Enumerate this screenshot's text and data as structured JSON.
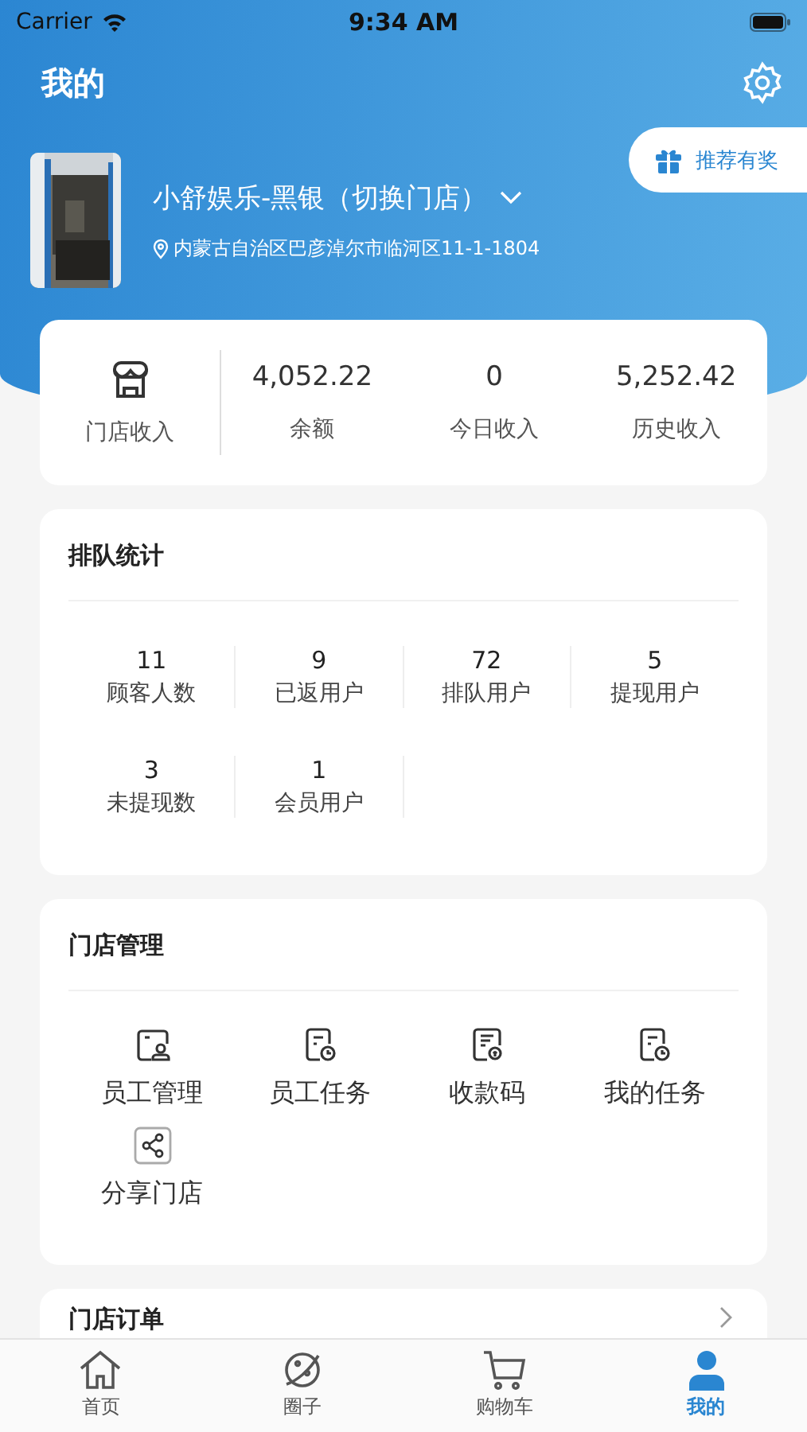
{
  "status_bar": {
    "carrier": "Carrier",
    "time": "9:34 AM"
  },
  "header": {
    "title": "我的"
  },
  "referral_button": {
    "label": "推荐有奖"
  },
  "store": {
    "name": "小舒娱乐-黑银（切换门店）",
    "address": "内蒙古自治区巴彦淖尔市临河区11-1-1804"
  },
  "income": {
    "label": "门店收入",
    "stats": [
      {
        "value": "4,052.22",
        "label": "余额"
      },
      {
        "value": "0",
        "label": "今日收入"
      },
      {
        "value": "5,252.42",
        "label": "历史收入"
      }
    ]
  },
  "queue_stats": {
    "title": "排队统计",
    "items": [
      {
        "value": "11",
        "label": "顾客人数"
      },
      {
        "value": "9",
        "label": "已返用户"
      },
      {
        "value": "72",
        "label": "排队用户"
      },
      {
        "value": "5",
        "label": "提现用户"
      },
      {
        "value": "3",
        "label": "未提现数"
      },
      {
        "value": "1",
        "label": "会员用户"
      }
    ]
  },
  "management": {
    "title": "门店管理",
    "items": [
      {
        "label": "员工管理",
        "kind": "staff"
      },
      {
        "label": "员工任务",
        "kind": "task"
      },
      {
        "label": "收款码",
        "kind": "payment"
      },
      {
        "label": "我的任务",
        "kind": "task"
      },
      {
        "label": "分享门店",
        "kind": "share"
      }
    ]
  },
  "orders": {
    "title": "门店订单"
  },
  "tab_bar": [
    {
      "label": "首页",
      "kind": "home",
      "selected": false
    },
    {
      "label": "圈子",
      "kind": "planet",
      "selected": false
    },
    {
      "label": "购物车",
      "kind": "cart",
      "selected": false
    },
    {
      "label": "我的",
      "kind": "person",
      "selected": true
    }
  ]
}
